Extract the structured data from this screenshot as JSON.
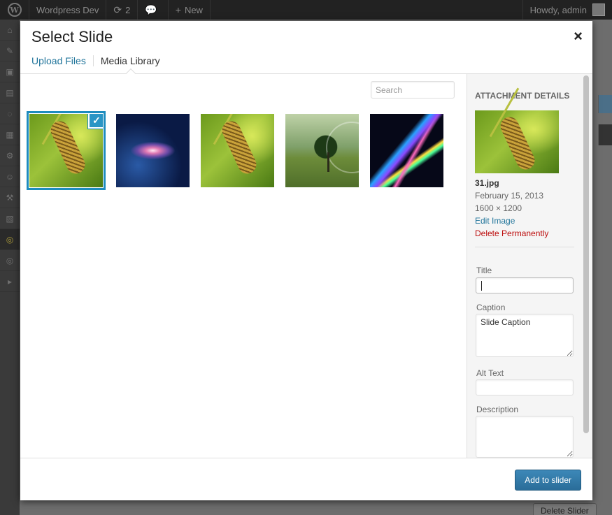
{
  "adminbar": {
    "site_name": "Wordpress Dev",
    "updates_count": "2",
    "new_label": "New",
    "howdy": "Howdy, admin"
  },
  "background": {
    "delete_slider_label": "Delete Slider"
  },
  "modal": {
    "title": "Select Slide",
    "close_glyph": "×",
    "tabs": [
      {
        "label": "Upload Files",
        "current": false
      },
      {
        "label": "Media Library",
        "current": true
      }
    ],
    "search": {
      "placeholder": "Search",
      "value": ""
    },
    "thumbnails": [
      {
        "icon": "grass-seedhead-image",
        "selected": true
      },
      {
        "icon": "galaxy-image",
        "selected": false
      },
      {
        "icon": "grass-seedhead-image",
        "selected": false
      },
      {
        "icon": "tree-landscape-image",
        "selected": false
      },
      {
        "icon": "abstract-light-lines-image",
        "selected": false
      }
    ],
    "selected_check_glyph": "✓",
    "details": {
      "heading": "Attachment Details",
      "filename": "31.jpg",
      "date": "February 15, 2013",
      "dimensions": "1600 × 1200",
      "edit_label": "Edit Image",
      "delete_label": "Delete Permanently"
    },
    "fields": {
      "title_label": "Title",
      "title_value": "",
      "caption_label": "Caption",
      "caption_value": "Slide Caption",
      "alt_label": "Alt Text",
      "alt_value": "",
      "description_label": "Description",
      "description_value": ""
    },
    "primary_button": "Add to slider"
  },
  "colors": {
    "accent": "#1e8cbe",
    "link": "#21759b",
    "delete": "#bc0b0b",
    "primary_button": "#2e7bae"
  }
}
